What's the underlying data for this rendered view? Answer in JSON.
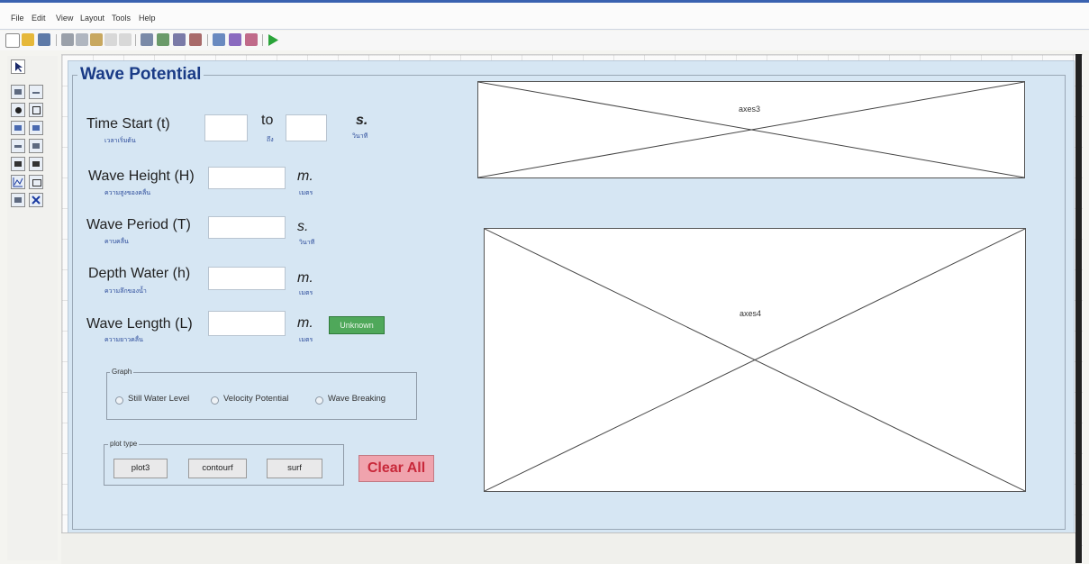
{
  "menu": [
    "File",
    "Edit",
    "View",
    "Layout",
    "Tools",
    "Help"
  ],
  "panel": {
    "title": "Wave Potential"
  },
  "fields": {
    "time_start": {
      "label": "Time Start (t)",
      "sub": "เวลาเริ่มต้น",
      "to": "to",
      "to_sub": "ถึง",
      "unit": "s.",
      "unit_sub": "วินาที"
    },
    "wave_height": {
      "label": "Wave Height (H)",
      "sub": "ความสูงของคลื่น",
      "unit": "m.",
      "unit_sub": "เมตร"
    },
    "wave_period": {
      "label": "Wave Period (T)",
      "sub": "คาบคลื่น",
      "unit": "s.",
      "unit_sub": "วินาที"
    },
    "depth_water": {
      "label": "Depth Water (h)",
      "sub": "ความลึกของน้ำ",
      "unit": "m.",
      "unit_sub": "เมตร"
    },
    "wave_length": {
      "label": "Wave Length (L)",
      "sub": "ความยาวคลื่น",
      "unit": "m.",
      "unit_sub": "เมตร",
      "button": "Unknown"
    }
  },
  "graph_group": {
    "title": "Graph",
    "options": [
      "Still Water Level",
      "Velocity Potential",
      "Wave Breaking"
    ]
  },
  "plot_group": {
    "title": "plot type",
    "buttons": [
      "plot3",
      "contourf",
      "surf"
    ]
  },
  "clear_all": "Clear All",
  "axes": [
    "axes3",
    "axes4"
  ],
  "colors": {
    "panel_bg": "#d6e6f3",
    "title": "#1a3b86",
    "unknown_btn": "#4fa85a",
    "clear_btn": "#f0a3ad",
    "clear_text": "#c8283a"
  }
}
